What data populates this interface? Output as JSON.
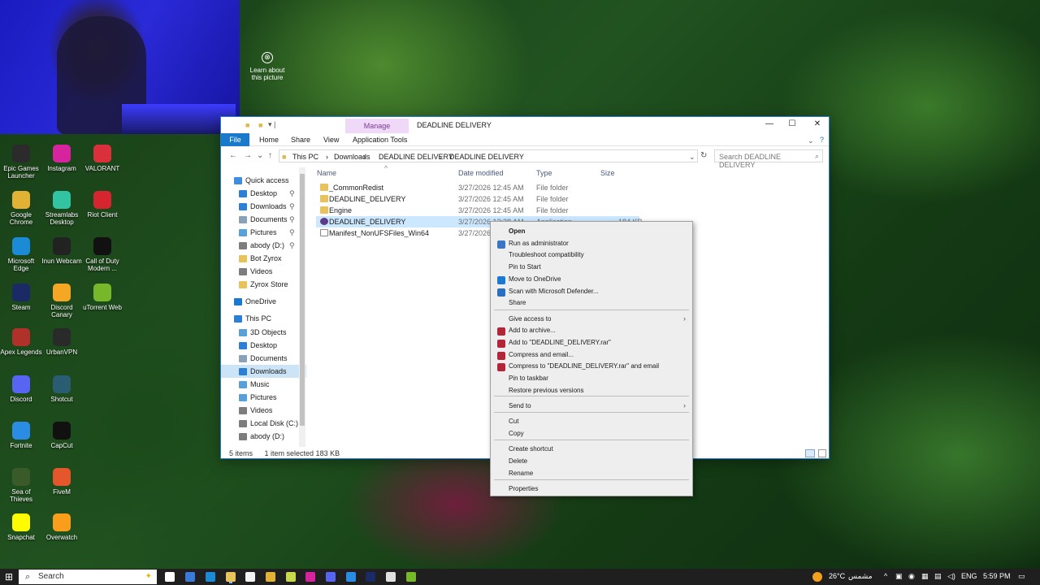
{
  "desktop": {
    "learn": "Learn about this picture",
    "icons": [
      {
        "label": "Epic Games Launcher",
        "color": "#2b2b2b"
      },
      {
        "label": "Instagram",
        "color": "#d6249f"
      },
      {
        "label": "VALORANT",
        "color": "#d9303b"
      },
      {
        "label": "Google Chrome",
        "color": "#e2b234"
      },
      {
        "label": "Streamlabs Desktop",
        "color": "#31c3a2"
      },
      {
        "label": "Riot Client",
        "color": "#d5252f"
      },
      {
        "label": "Microsoft Edge",
        "color": "#1c8bd6"
      },
      {
        "label": "Inun Webcam",
        "color": "#222222"
      },
      {
        "label": "Call of Duty Modern ...",
        "color": "#111111"
      },
      {
        "label": "Steam",
        "color": "#1b2a66"
      },
      {
        "label": "Discord Canary",
        "color": "#f5a623"
      },
      {
        "label": "uTorrent Web",
        "color": "#76b82a"
      },
      {
        "label": "Apex Legends",
        "color": "#b0312a"
      },
      {
        "label": "UrbanVPN",
        "color": "#2a2a2a"
      },
      {
        "label": "Discord",
        "color": "#5865f2"
      },
      {
        "label": "Shotcut",
        "color": "#2a5d72"
      },
      {
        "label": "Fortnite",
        "color": "#2b8ce3"
      },
      {
        "label": "CapCut",
        "color": "#111111"
      },
      {
        "label": "Sea of Thieves",
        "color": "#3b5a2a"
      },
      {
        "label": "FiveM",
        "color": "#e4562b"
      },
      {
        "label": "Snapchat",
        "color": "#fffc00"
      },
      {
        "label": "Overwatch",
        "color": "#f99e1a"
      }
    ]
  },
  "explorer": {
    "manage": "Manage",
    "title": "DEADLINE DELIVERY",
    "ribbon": {
      "file": "File",
      "home": "Home",
      "share": "Share",
      "view": "View",
      "app_tools": "Application Tools"
    },
    "crumbs": [
      "This PC",
      "Downloads",
      "DEADLINE DELIVERY",
      "DEADLINE DELIVERY"
    ],
    "search_placeholder": "Search DEADLINE DELIVERY",
    "nav": [
      {
        "label": "Quick access",
        "color": "#3d8ee0"
      },
      {
        "label": "Desktop",
        "color": "#2d7fd6"
      },
      {
        "label": "Downloads",
        "color": "#2d7fd6"
      },
      {
        "label": "Documents",
        "color": "#8aa2b8"
      },
      {
        "label": "Pictures",
        "color": "#5aa0d8"
      },
      {
        "label": "abody (D:)",
        "color": "#7d7d7d"
      },
      {
        "label": "Bot Zyrox",
        "color": "#e8c25a"
      },
      {
        "label": "Videos",
        "color": "#7d7d7d"
      },
      {
        "label": "Zyrox Store",
        "color": "#e8c25a"
      },
      {
        "label": "OneDrive",
        "color": "#1b79d0"
      },
      {
        "label": "This PC",
        "color": "#2d7fd6"
      },
      {
        "label": "3D Objects",
        "color": "#5aa0d8"
      },
      {
        "label": "Desktop",
        "color": "#2d7fd6"
      },
      {
        "label": "Documents",
        "color": "#8aa2b8"
      },
      {
        "label": "Downloads",
        "color": "#2d7fd6"
      },
      {
        "label": "Music",
        "color": "#5aa0d8"
      },
      {
        "label": "Pictures",
        "color": "#5aa0d8"
      },
      {
        "label": "Videos",
        "color": "#7d7d7d"
      },
      {
        "label": "Local Disk (C:)",
        "color": "#7d7d7d"
      },
      {
        "label": "abody (D:)",
        "color": "#7d7d7d"
      }
    ],
    "columns": {
      "name": "Name",
      "date": "Date modified",
      "type": "Type",
      "size": "Size"
    },
    "files": [
      {
        "name": "_CommonRedist",
        "date": "3/27/2026 12:45 AM",
        "type": "File folder",
        "size": ""
      },
      {
        "name": "DEADLINE_DELIVERY",
        "date": "3/27/2026 12:45 AM",
        "type": "File folder",
        "size": ""
      },
      {
        "name": "Engine",
        "date": "3/27/2026 12:45 AM",
        "type": "File folder",
        "size": ""
      },
      {
        "name": "DEADLINE_DELIVERY",
        "date": "3/27/2026 12:28 AM",
        "type": "Application",
        "size": "184 KB"
      },
      {
        "name": "Manifest_NonUFSFiles_Win64",
        "date": "3/27/2026 1",
        "type": "",
        "size": ""
      }
    ],
    "status": {
      "items": "5 items",
      "selected": "1 item selected  183 KB"
    }
  },
  "context_menu": {
    "items": [
      {
        "label": "Open",
        "bold": true
      },
      {
        "label": "Run as administrator",
        "icon_color": "#3a76c4"
      },
      {
        "label": "Troubleshoot compatibility"
      },
      {
        "label": "Pin to Start"
      },
      {
        "label": "Move to OneDrive",
        "icon_color": "#1b79d0"
      },
      {
        "label": "Scan with Microsoft Defender...",
        "icon_color": "#2a6fc1"
      },
      {
        "label": "Share"
      },
      {
        "label": "Give access to",
        "submenu": true
      },
      {
        "label": "Add to archive...",
        "icon_color": "#b3263a"
      },
      {
        "label": "Add to \"DEADLINE_DELIVERY.rar\"",
        "icon_color": "#b3263a"
      },
      {
        "label": "Compress and email...",
        "icon_color": "#b3263a"
      },
      {
        "label": "Compress to \"DEADLINE_DELIVERY.rar\" and email",
        "icon_color": "#b3263a"
      },
      {
        "label": "Pin to taskbar"
      },
      {
        "label": "Restore previous versions"
      },
      {
        "label": "Send to",
        "submenu": true
      },
      {
        "label": "Cut"
      },
      {
        "label": "Copy"
      },
      {
        "label": "Create shortcut"
      },
      {
        "label": "Delete"
      },
      {
        "label": "Rename"
      },
      {
        "label": "Properties"
      }
    ]
  },
  "taskbar": {
    "search": "Search",
    "weather": "26°C",
    "weather_text": "مشمس",
    "lang": "ENG",
    "time": "5:59 PM"
  }
}
